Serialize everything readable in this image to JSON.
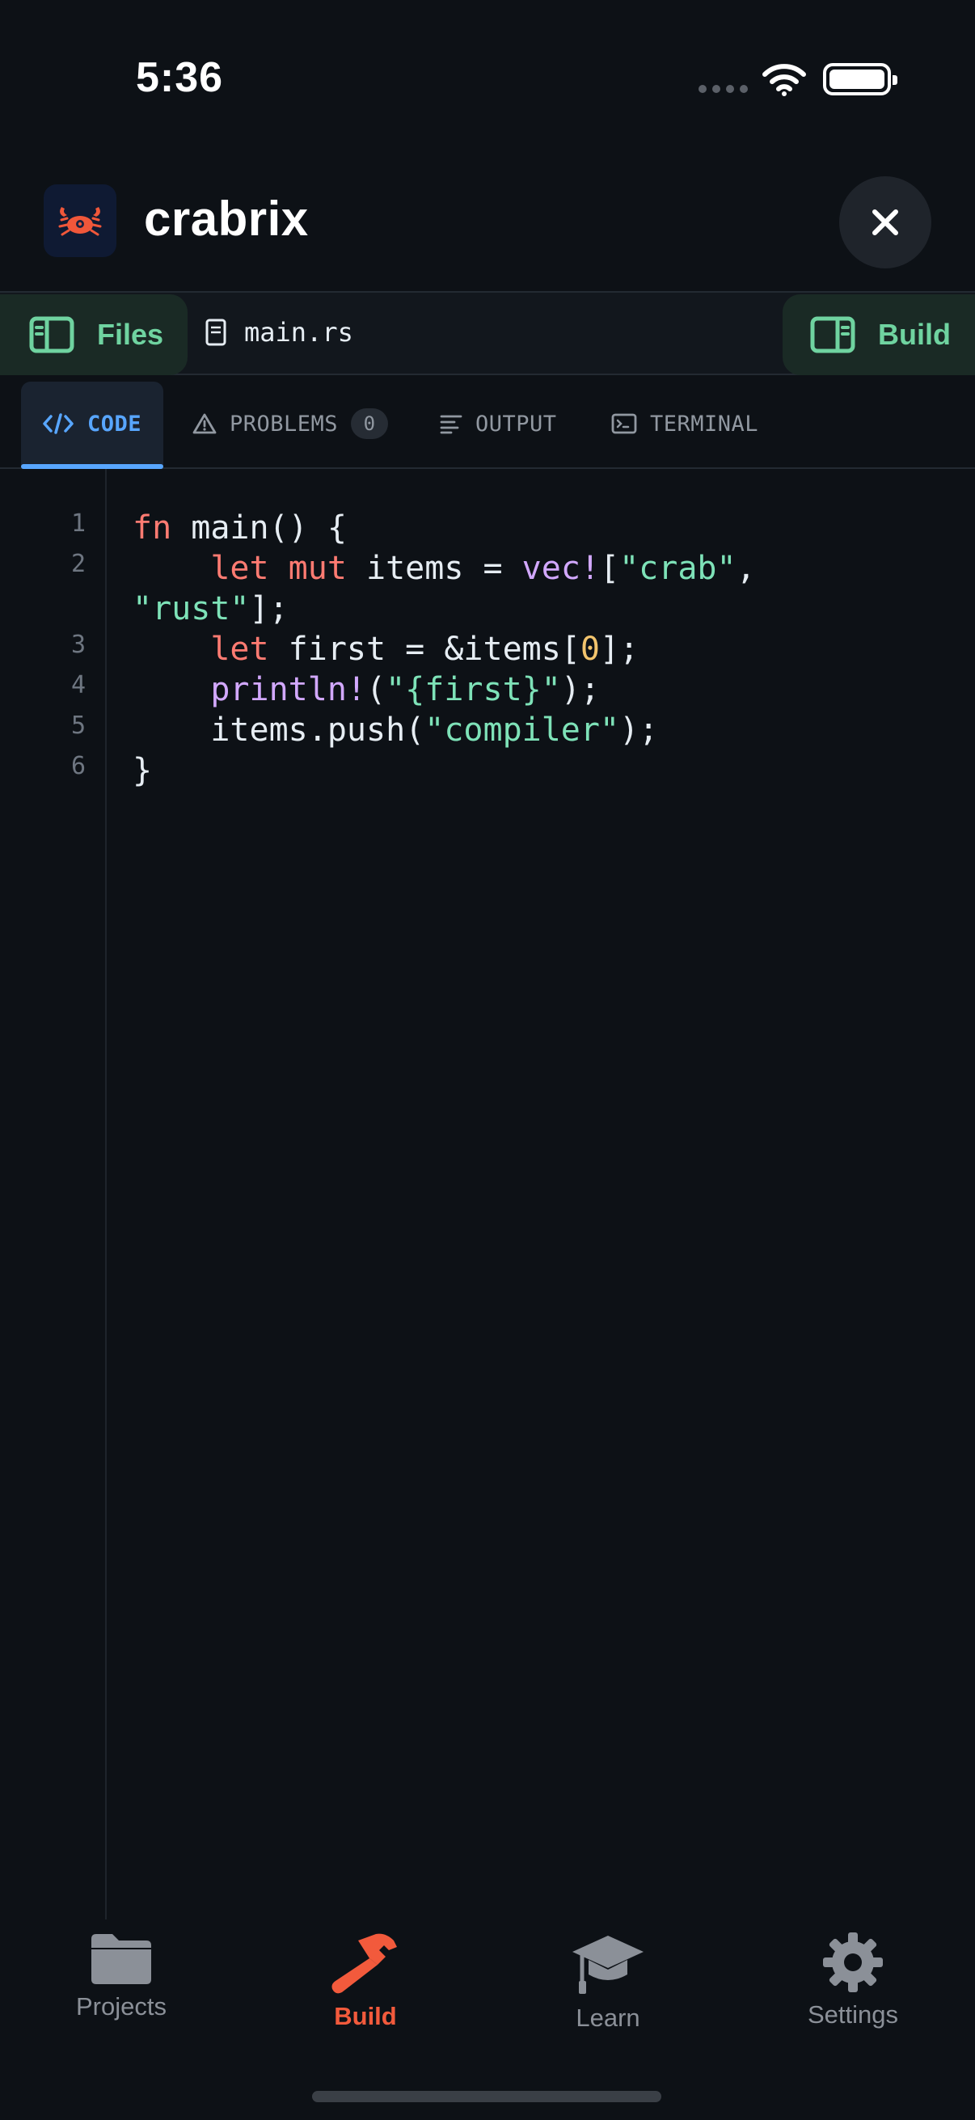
{
  "status_bar": {
    "time": "5:36"
  },
  "app": {
    "title": "crabrix",
    "logo_icon": "crab-icon"
  },
  "files_bar": {
    "files_label": "Files",
    "current_file": "main.rs",
    "build_label": "Build"
  },
  "panel_tabs": [
    {
      "label": "CODE",
      "icon": "code-icon",
      "active": true
    },
    {
      "label": "PROBLEMS",
      "icon": "warning-icon",
      "badge": "0"
    },
    {
      "label": "OUTPUT",
      "icon": "lines-icon"
    },
    {
      "label": "TERMINAL",
      "icon": "terminal-icon"
    }
  ],
  "editor": {
    "line_numbers": [
      "1",
      "2",
      "3",
      "4",
      "5",
      "6"
    ],
    "lines": [
      [
        {
          "t": "fn",
          "c": "kw"
        },
        {
          "t": " main() {"
        }
      ],
      [
        {
          "t": "    "
        },
        {
          "t": "let",
          "c": "kw"
        },
        {
          "t": " "
        },
        {
          "t": "mut",
          "c": "kw"
        },
        {
          "t": " items = "
        },
        {
          "t": "vec!",
          "c": "mac"
        },
        {
          "t": "["
        },
        {
          "t": "\"crab\"",
          "c": "str"
        },
        {
          "t": ","
        }
      ],
      [
        {
          "t": "\"rust\"",
          "c": "str"
        },
        {
          "t": "];"
        }
      ],
      [
        {
          "t": "    "
        },
        {
          "t": "let",
          "c": "kw"
        },
        {
          "t": " first = &items["
        },
        {
          "t": "0",
          "c": "num"
        },
        {
          "t": "];"
        }
      ],
      [
        {
          "t": "    "
        },
        {
          "t": "println!",
          "c": "mac"
        },
        {
          "t": "("
        },
        {
          "t": "\"{first}\"",
          "c": "str"
        },
        {
          "t": ");"
        }
      ],
      [
        {
          "t": "    items.push("
        },
        {
          "t": "\"compiler\"",
          "c": "str"
        },
        {
          "t": ");"
        }
      ],
      [
        {
          "t": "}"
        }
      ]
    ]
  },
  "bottom_nav": [
    {
      "label": "Projects",
      "icon": "folder-icon"
    },
    {
      "label": "Build",
      "icon": "hammer-icon",
      "active": true
    },
    {
      "label": "Learn",
      "icon": "graduation-cap-icon"
    },
    {
      "label": "Settings",
      "icon": "gear-icon"
    }
  ],
  "colors": {
    "background": "#0d1116",
    "accent_green": "#6fd3a0",
    "accent_blue": "#58a6ff",
    "accent_orange": "#f25a3c",
    "keyword": "#ff7b72",
    "macro": "#d2a8ff",
    "string": "#7ee2b8",
    "number": "#f2c46d"
  }
}
